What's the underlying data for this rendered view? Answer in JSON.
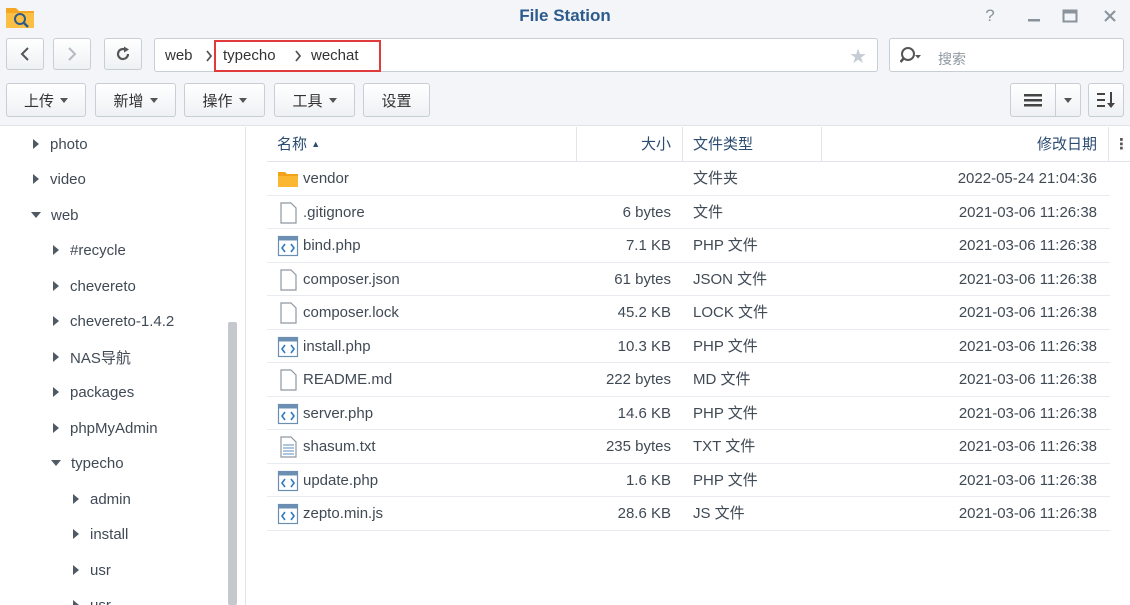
{
  "window": {
    "title": "File Station"
  },
  "nav": {
    "breadcrumb": [
      "web",
      "typecho",
      "wechat"
    ],
    "search_placeholder": "搜索"
  },
  "toolbar": {
    "upload": "上传",
    "create": "新增",
    "action": "操作",
    "tools": "工具",
    "settings": "设置"
  },
  "tree": [
    {
      "label": "photo",
      "level": 0,
      "expanded": false
    },
    {
      "label": "video",
      "level": 0,
      "expanded": false
    },
    {
      "label": "web",
      "level": 0,
      "expanded": true
    },
    {
      "label": "#recycle",
      "level": 1,
      "expanded": false
    },
    {
      "label": "chevereto",
      "level": 1,
      "expanded": false
    },
    {
      "label": "chevereto-1.4.2",
      "level": 1,
      "expanded": false
    },
    {
      "label": "NAS导航",
      "level": 1,
      "expanded": false
    },
    {
      "label": "packages",
      "level": 1,
      "expanded": false
    },
    {
      "label": "phpMyAdmin",
      "level": 1,
      "expanded": false
    },
    {
      "label": "typecho",
      "level": 1,
      "expanded": true
    },
    {
      "label": "admin",
      "level": 2,
      "expanded": false
    },
    {
      "label": "install",
      "level": 2,
      "expanded": false
    },
    {
      "label": "usr",
      "level": 2,
      "expanded": false
    },
    {
      "label": "usr",
      "level": 2,
      "expanded": false
    }
  ],
  "table": {
    "columns": {
      "name": "名称",
      "size": "大小",
      "type": "文件类型",
      "modified": "修改日期"
    },
    "rows": [
      {
        "name": "vendor",
        "size": "",
        "type": "文件夹",
        "modified": "2022-05-24 21:04:36",
        "icon": "folder-icon"
      },
      {
        "name": ".gitignore",
        "size": "6 bytes",
        "type": "文件",
        "modified": "2021-03-06 11:26:38",
        "icon": "file-icon"
      },
      {
        "name": "bind.php",
        "size": "7.1 KB",
        "type": "PHP 文件",
        "modified": "2021-03-06 11:26:38",
        "icon": "code-file-icon"
      },
      {
        "name": "composer.json",
        "size": "61 bytes",
        "type": "JSON 文件",
        "modified": "2021-03-06 11:26:38",
        "icon": "file-icon"
      },
      {
        "name": "composer.lock",
        "size": "45.2 KB",
        "type": "LOCK 文件",
        "modified": "2021-03-06 11:26:38",
        "icon": "file-icon"
      },
      {
        "name": "install.php",
        "size": "10.3 KB",
        "type": "PHP 文件",
        "modified": "2021-03-06 11:26:38",
        "icon": "code-file-icon"
      },
      {
        "name": "README.md",
        "size": "222 bytes",
        "type": "MD 文件",
        "modified": "2021-03-06 11:26:38",
        "icon": "file-icon"
      },
      {
        "name": "server.php",
        "size": "14.6 KB",
        "type": "PHP 文件",
        "modified": "2021-03-06 11:26:38",
        "icon": "code-file-icon"
      },
      {
        "name": "shasum.txt",
        "size": "235 bytes",
        "type": "TXT 文件",
        "modified": "2021-03-06 11:26:38",
        "icon": "text-file-icon"
      },
      {
        "name": "update.php",
        "size": "1.6 KB",
        "type": "PHP 文件",
        "modified": "2021-03-06 11:26:38",
        "icon": "code-file-icon"
      },
      {
        "name": "zepto.min.js",
        "size": "28.6 KB",
        "type": "JS 文件",
        "modified": "2021-03-06 11:26:38",
        "icon": "code-file-icon"
      }
    ]
  },
  "colors": {
    "accent": "#2c5b8c",
    "highlight": "#e03a3a",
    "folder": "#f5a623"
  }
}
